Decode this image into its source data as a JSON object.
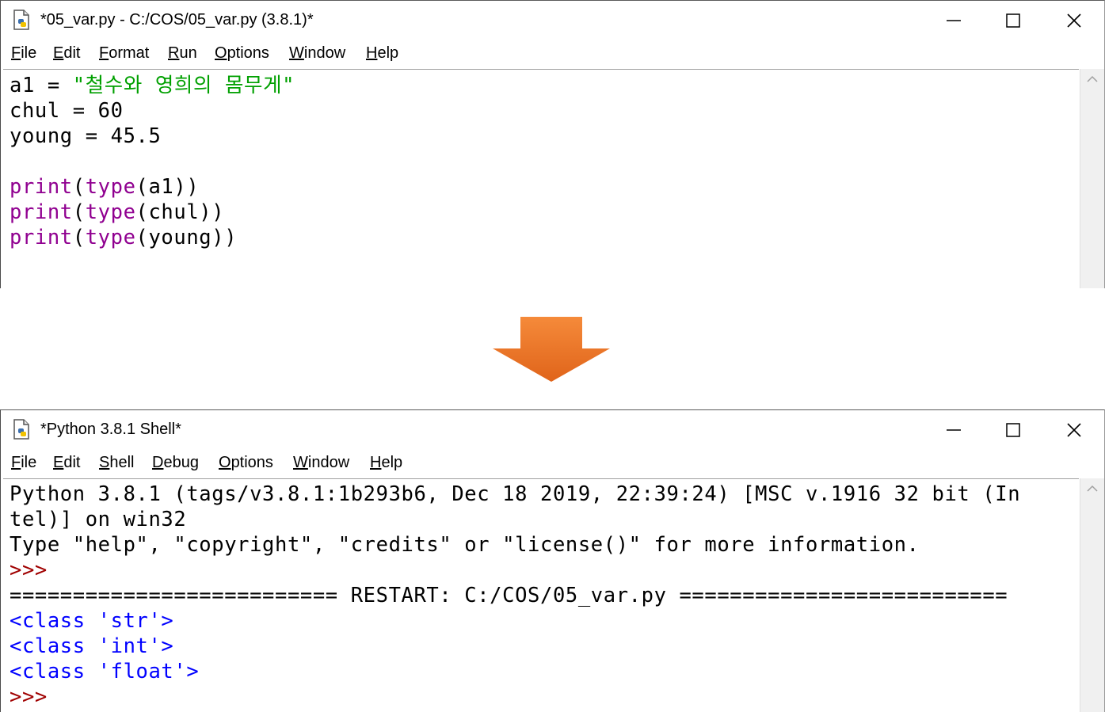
{
  "editor": {
    "title": "*05_var.py - C:/COS/05_var.py (3.8.1)*",
    "menu": [
      {
        "u": "F",
        "rest": "ile"
      },
      {
        "u": "E",
        "rest": "dit"
      },
      {
        "u": "F",
        "rest": "ormat"
      },
      {
        "u": "R",
        "rest": "un"
      },
      {
        "u": "O",
        "rest": "ptions"
      },
      {
        "u": "W",
        "rest": "indow"
      },
      {
        "u": "H",
        "rest": "elp"
      }
    ],
    "lines": [
      {
        "plain": "a1 = ",
        "string": "\"철수와 영희의 몸무게\""
      },
      {
        "plain": "chul = 60"
      },
      {
        "plain": "young = 45.5"
      },
      {
        "plain": ""
      },
      {
        "kw1": "print",
        "p1": "(",
        "kw2": "type",
        "p2": "(a1))"
      },
      {
        "kw1": "print",
        "p1": "(",
        "kw2": "type",
        "p2": "(chul))"
      },
      {
        "kw1": "print",
        "p1": "(",
        "kw2": "type",
        "p2": "(young))"
      }
    ]
  },
  "shell": {
    "title": "*Python 3.8.1 Shell*",
    "menu": [
      {
        "u": "F",
        "rest": "ile"
      },
      {
        "u": "E",
        "rest": "dit"
      },
      {
        "u": "S",
        "rest": "hell"
      },
      {
        "u": "D",
        "rest": "ebug"
      },
      {
        "u": "O",
        "rest": "ptions"
      },
      {
        "u": "W",
        "rest": "indow"
      },
      {
        "u": "H",
        "rest": "elp"
      }
    ],
    "lines": [
      {
        "text": "Python 3.8.1 (tags/v3.8.1:1b293b6, Dec 18 2019, 22:39:24) [MSC v.1916 32 bit (In"
      },
      {
        "text": "tel)] on win32"
      },
      {
        "text": "Type \"help\", \"copyright\", \"credits\" or \"license()\" for more information."
      },
      {
        "prompt": ">>> "
      },
      {
        "text": "========================== RESTART: C:/COS/05_var.py =========================="
      },
      {
        "output": "<class 'str'>"
      },
      {
        "output": "<class 'int'>"
      },
      {
        "output": "<class 'float'>"
      },
      {
        "prompt": ">>> "
      }
    ]
  },
  "colors": {
    "keyword": "#900090",
    "string": "#00a000",
    "output": "#0000ff",
    "prompt": "#a00000",
    "arrow": "#f07f30"
  },
  "icons": [
    "python-file-icon",
    "minimize-icon",
    "maximize-icon",
    "close-icon",
    "scroll-up-arrow-icon",
    "down-arrow-icon"
  ]
}
